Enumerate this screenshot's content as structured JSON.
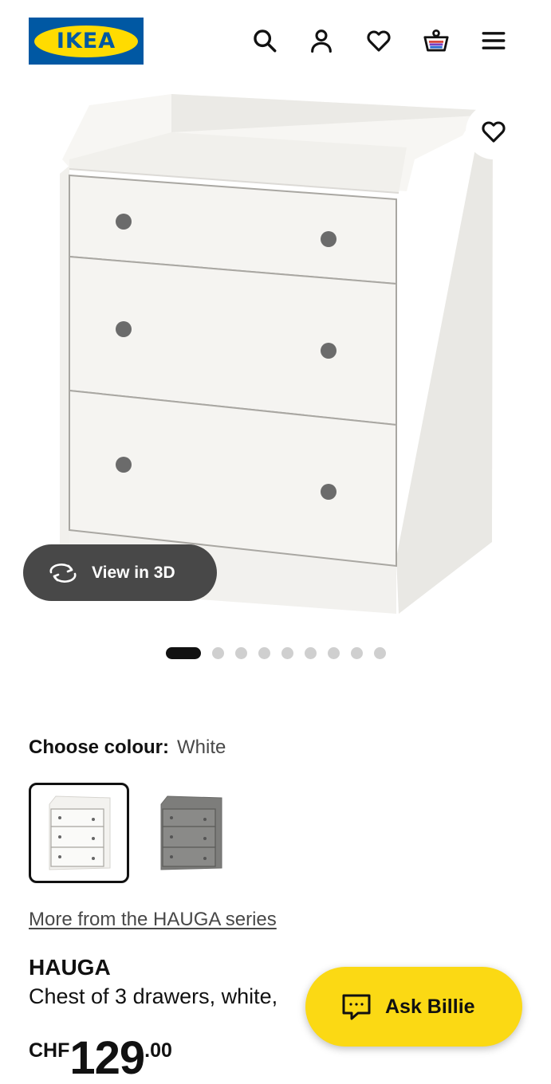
{
  "header": {
    "logo_text": "IKEA",
    "icons": [
      "search-icon",
      "account-icon",
      "favourites-icon",
      "basket-icon",
      "menu-icon"
    ]
  },
  "gallery": {
    "view_3d_label": "View in 3D",
    "image_count": 9,
    "active_index": 0
  },
  "colour": {
    "label": "Choose colour:",
    "selected": "White",
    "options": [
      "White",
      "Grey"
    ]
  },
  "series_link": "More from the HAUGA series",
  "product": {
    "name": "HAUGA",
    "description": "Chest of 3 drawers, white,",
    "currency": "CHF",
    "price_integer": "129",
    "price_decimal": ".00"
  },
  "chat": {
    "label": "Ask Billie"
  },
  "colors": {
    "ikea_blue": "#0058a3",
    "ikea_yellow": "#ffdb00",
    "billie_yellow": "#fbd914",
    "text": "#111111",
    "muted_text": "#484848"
  }
}
